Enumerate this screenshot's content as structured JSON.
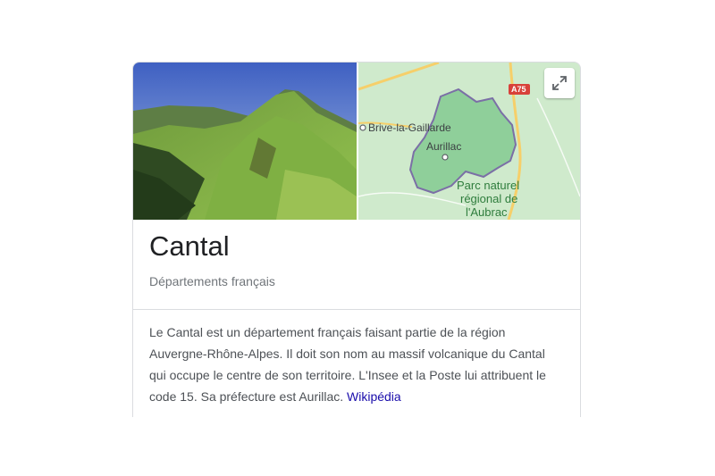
{
  "panel": {
    "title": "Cantal",
    "subtitle": "Départements français",
    "description": "Le Cantal est un département français faisant partie de la région Auvergne-Rhône-Alpes. Il doit son nom au massif volcanique du Cantal qui occupe le centre de son territoire. L'Insee et la Poste lui attribuent le code 15. Sa préfecture est Aurillac.",
    "source_link": "Wikipédia"
  },
  "map": {
    "labels": {
      "brive": "Brive-la-Gaillarde",
      "aurillac": "Aurillac",
      "park_line1": "Parc naturel",
      "park_line2": "régional de",
      "park_line3": "l'Aubrac",
      "highway": "A75"
    }
  },
  "icons": {
    "expand": "expand-icon"
  },
  "colors": {
    "link": "#1a0dab",
    "title": "#202124",
    "subtitle": "#70757a",
    "body_text": "#4d5156",
    "map_land": "#cfeacc",
    "region_fill": "#8fcf9a",
    "region_border": "#7b6fa6",
    "road": "#f6cf6a"
  }
}
